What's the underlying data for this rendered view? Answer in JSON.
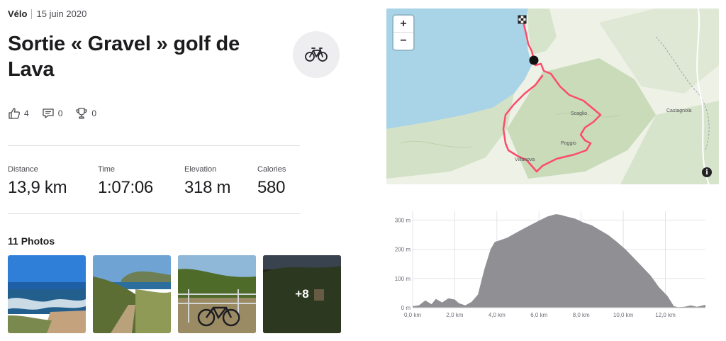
{
  "activity": {
    "sport": "Vélo",
    "date": "15 juin 2020",
    "title": "Sortie « Gravel » golf de Lava",
    "sport_icon": "bike-icon"
  },
  "social": {
    "kudos_count": "4",
    "comments_count": "0",
    "achievements_count": "0"
  },
  "stats": [
    {
      "label": "Distance",
      "value": "13,9 km"
    },
    {
      "label": "Time",
      "value": "1:07:06"
    },
    {
      "label": "Elevation",
      "value": "318 m"
    },
    {
      "label": "Calories",
      "value": "580"
    }
  ],
  "photos": {
    "title": "11 Photos",
    "more_label": "+8"
  },
  "map": {
    "zoom_in": "+",
    "zoom_out": "−",
    "info": "i",
    "places": [
      "Scaglio",
      "Poggio",
      "Villanova",
      "Castagnola"
    ],
    "route_color": "#fc4c6a",
    "water_color": "#a9d3e6",
    "land_color": "#eef1e6"
  },
  "chart_data": {
    "type": "area",
    "x": [
      0.0,
      0.3,
      0.6,
      0.9,
      1.1,
      1.4,
      1.7,
      2.0,
      2.2,
      2.5,
      2.8,
      3.1,
      3.4,
      3.7,
      3.9,
      4.2,
      4.5,
      4.8,
      5.2,
      5.6,
      6.0,
      6.4,
      6.8,
      7.0,
      7.3,
      7.7,
      8.1,
      8.5,
      8.9,
      9.3,
      9.7,
      10.1,
      10.5,
      10.9,
      11.3,
      11.7,
      12.1,
      12.4,
      12.6,
      12.9,
      13.2,
      13.5,
      13.9
    ],
    "y": [
      5,
      8,
      25,
      12,
      30,
      18,
      32,
      28,
      15,
      8,
      20,
      45,
      130,
      200,
      225,
      232,
      240,
      252,
      268,
      283,
      298,
      312,
      320,
      318,
      312,
      305,
      292,
      282,
      265,
      248,
      225,
      200,
      170,
      140,
      110,
      70,
      40,
      5,
      2,
      3,
      8,
      3,
      10
    ],
    "xlabel": "",
    "ylabel": "",
    "xlim": [
      0,
      13.9
    ],
    "ylim": [
      0,
      330
    ],
    "x_ticks": [
      "0,0 km",
      "2,0 km",
      "4,0 km",
      "6,0 km",
      "8,0 km",
      "10,0 km",
      "12,0 km"
    ],
    "x_tick_values": [
      0,
      2,
      4,
      6,
      8,
      10,
      12
    ],
    "y_ticks": [
      "0 m",
      "100 m",
      "200 m",
      "300 m"
    ],
    "y_tick_values": [
      0,
      100,
      200,
      300
    ],
    "grid": true,
    "fill_color": "#8a8a8e"
  }
}
